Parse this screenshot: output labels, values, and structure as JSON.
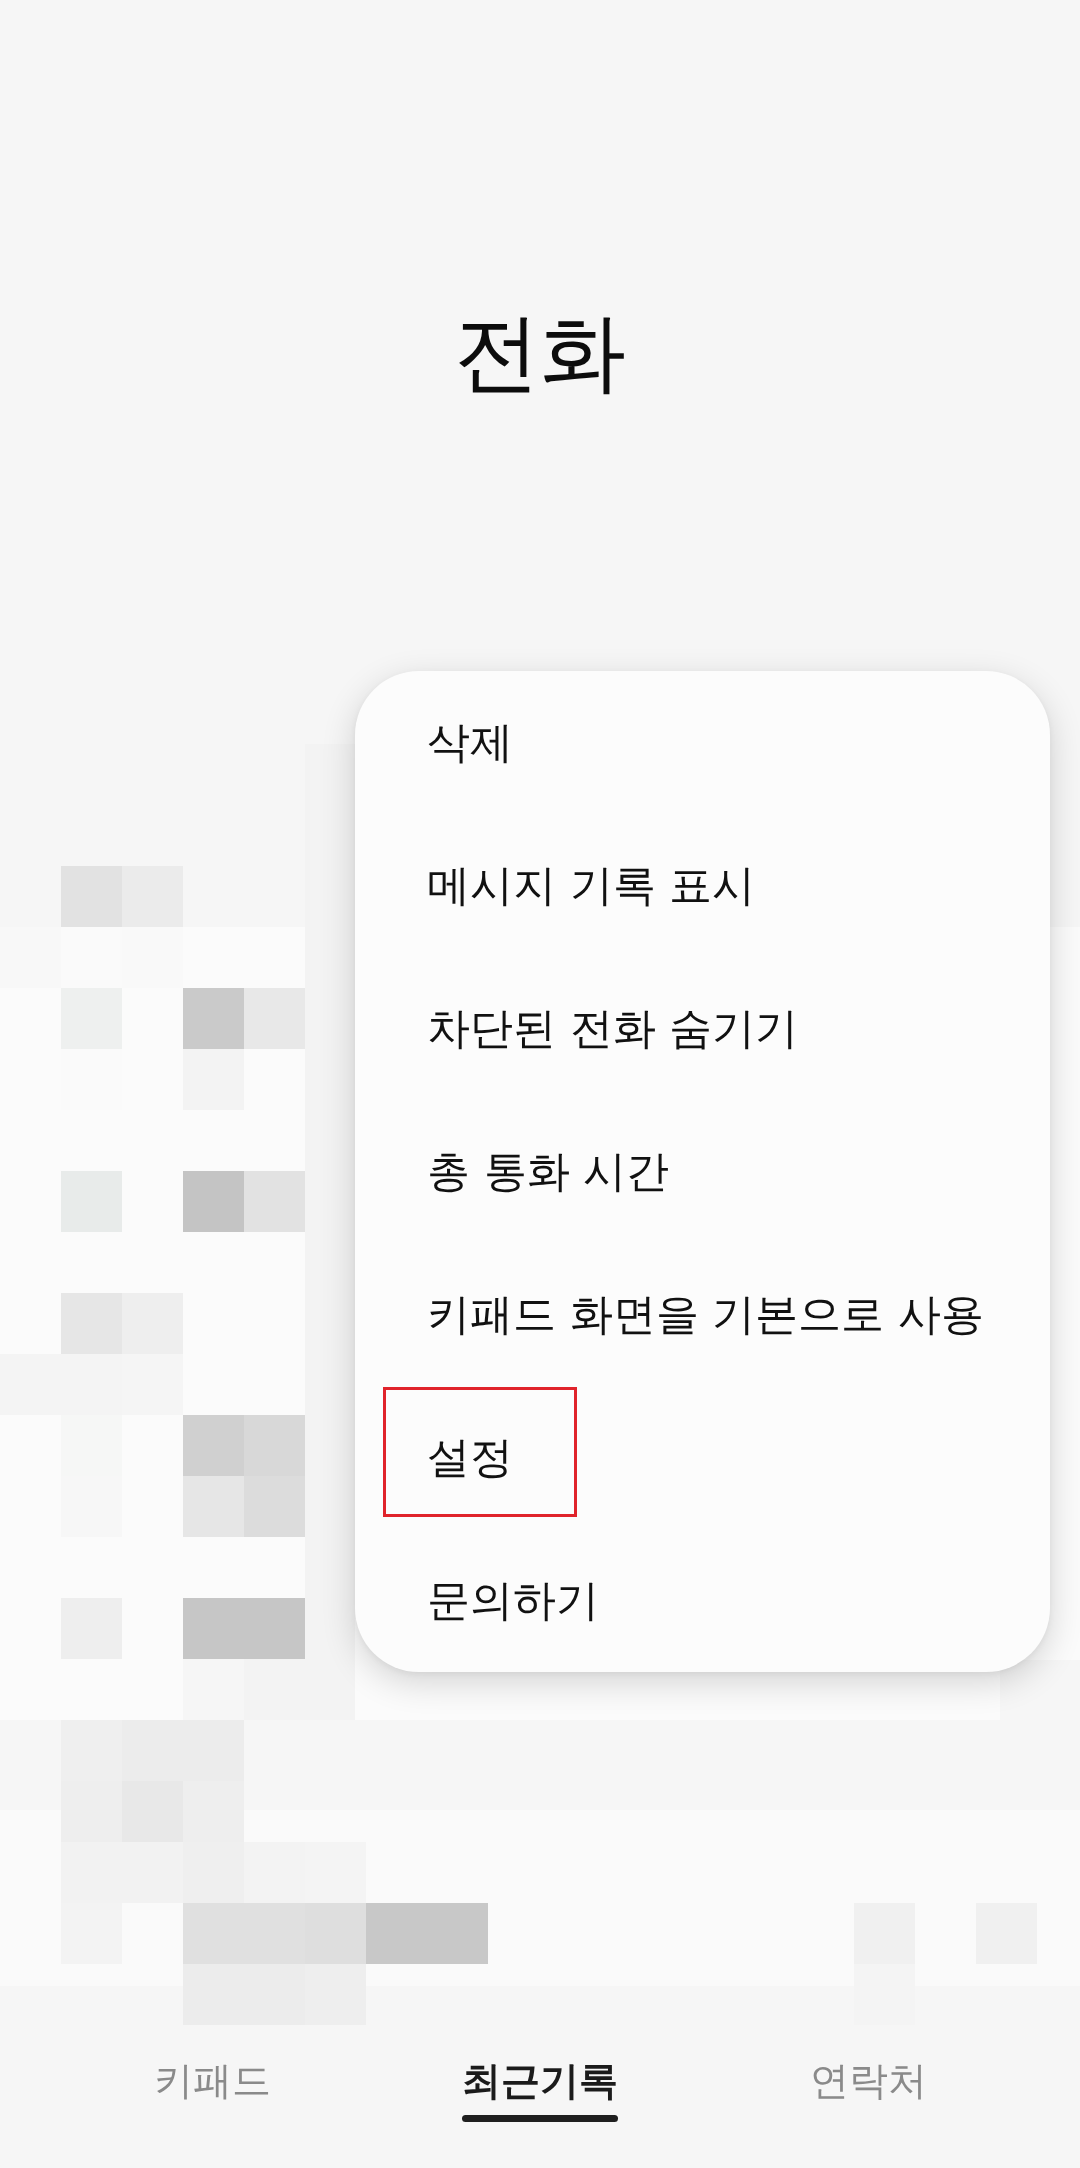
{
  "app_title": "전화",
  "menu": {
    "items": [
      {
        "label": "삭제",
        "highlighted": false
      },
      {
        "label": "메시지 기록 표시",
        "highlighted": false
      },
      {
        "label": "차단된 전화 숨기기",
        "highlighted": false
      },
      {
        "label": "총 통화 시간",
        "highlighted": false
      },
      {
        "label": "키패드 화면을 기본으로 사용",
        "highlighted": false
      },
      {
        "label": "설정",
        "highlighted": true
      },
      {
        "label": "문의하기",
        "highlighted": false
      }
    ]
  },
  "bottom_tabs": [
    {
      "label": "키패드",
      "selected": false
    },
    {
      "label": "최근기록",
      "selected": true
    },
    {
      "label": "연락처",
      "selected": false
    }
  ]
}
